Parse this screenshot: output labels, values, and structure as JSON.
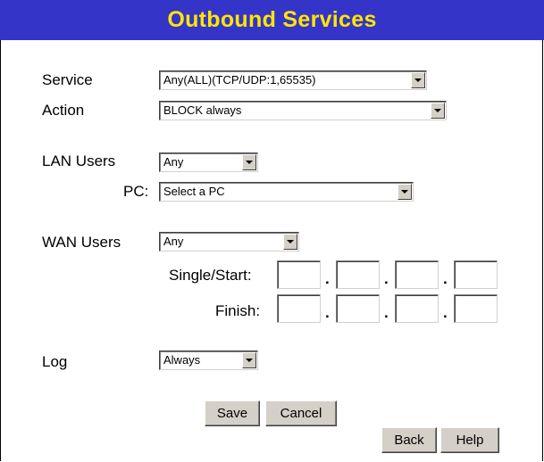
{
  "title": "Outbound Services",
  "service": {
    "label": "Service",
    "value": "Any(ALL)(TCP/UDP:1,65535)"
  },
  "action": {
    "label": "Action",
    "value": "BLOCK always"
  },
  "lan_users": {
    "label": "LAN Users",
    "value": "Any"
  },
  "pc": {
    "label": "PC:",
    "value": "Select a PC"
  },
  "wan_users": {
    "label": "WAN Users",
    "value": "Any"
  },
  "single_start": {
    "label": "Single/Start:",
    "octets": [
      "",
      "",
      "",
      ""
    ]
  },
  "finish": {
    "label": "Finish:",
    "octets": [
      "",
      "",
      "",
      ""
    ]
  },
  "ip_separator": ".",
  "log": {
    "label": "Log",
    "value": "Always"
  },
  "buttons": {
    "save": "Save",
    "cancel": "Cancel",
    "back": "Back",
    "help": "Help"
  },
  "colors": {
    "title_bg": "#3434c8",
    "title_text": "#ffe600",
    "button_face": "#d4d0c8"
  }
}
